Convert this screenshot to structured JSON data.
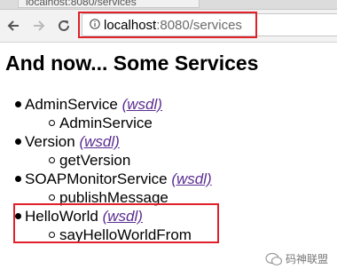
{
  "browser": {
    "tab_title": "localhost:8080/services",
    "url_host": "localhost",
    "url_rest": ":8080/services"
  },
  "page": {
    "heading": "And now... Some Services",
    "services": [
      {
        "name": "AdminService",
        "wsdl_label": "(wsdl)",
        "operations": [
          "AdminService"
        ]
      },
      {
        "name": "Version",
        "wsdl_label": "(wsdl)",
        "operations": [
          "getVersion"
        ]
      },
      {
        "name": "SOAPMonitorService",
        "wsdl_label": "(wsdl)",
        "operations": [
          "publishMessage"
        ]
      },
      {
        "name": "HelloWorld",
        "wsdl_label": "(wsdl)",
        "operations": [
          "sayHelloWorldFrom"
        ]
      }
    ]
  },
  "watermark": {
    "text": "码神联盟"
  },
  "colors": {
    "highlight": "#e0202a",
    "link_visited": "#5b2d91"
  },
  "icons": {
    "back": "arrow-left-icon",
    "forward": "arrow-right-icon",
    "reload": "reload-icon",
    "info": "info-icon"
  }
}
